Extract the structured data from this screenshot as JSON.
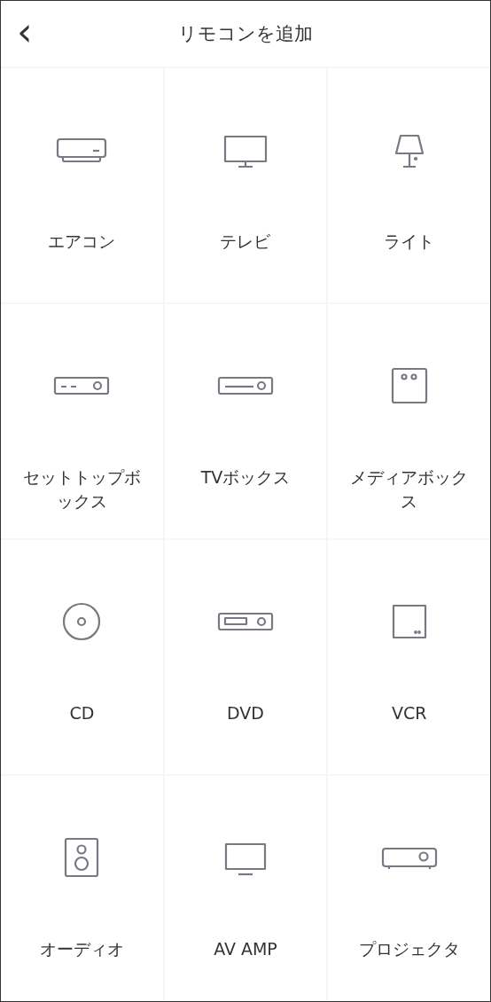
{
  "header": {
    "back": "‹",
    "title": "リモコンを追加"
  },
  "devices": [
    {
      "label": "エアコン",
      "kind": "aircon"
    },
    {
      "label": "テレビ",
      "kind": "tv"
    },
    {
      "label": "ライト",
      "kind": "lamp"
    },
    {
      "label": "セットトップボックス",
      "kind": "settopbox"
    },
    {
      "label": "TVボックス",
      "kind": "tvbox"
    },
    {
      "label": "メディアボックス",
      "kind": "mediabox"
    },
    {
      "label": "CD",
      "kind": "cd"
    },
    {
      "label": "DVD",
      "kind": "dvd"
    },
    {
      "label": "VCR",
      "kind": "vcr"
    },
    {
      "label": "オーディオ",
      "kind": "speaker"
    },
    {
      "label": "AV AMP",
      "kind": "monitor"
    },
    {
      "label": "プロジェクタ",
      "kind": "projector"
    }
  ]
}
